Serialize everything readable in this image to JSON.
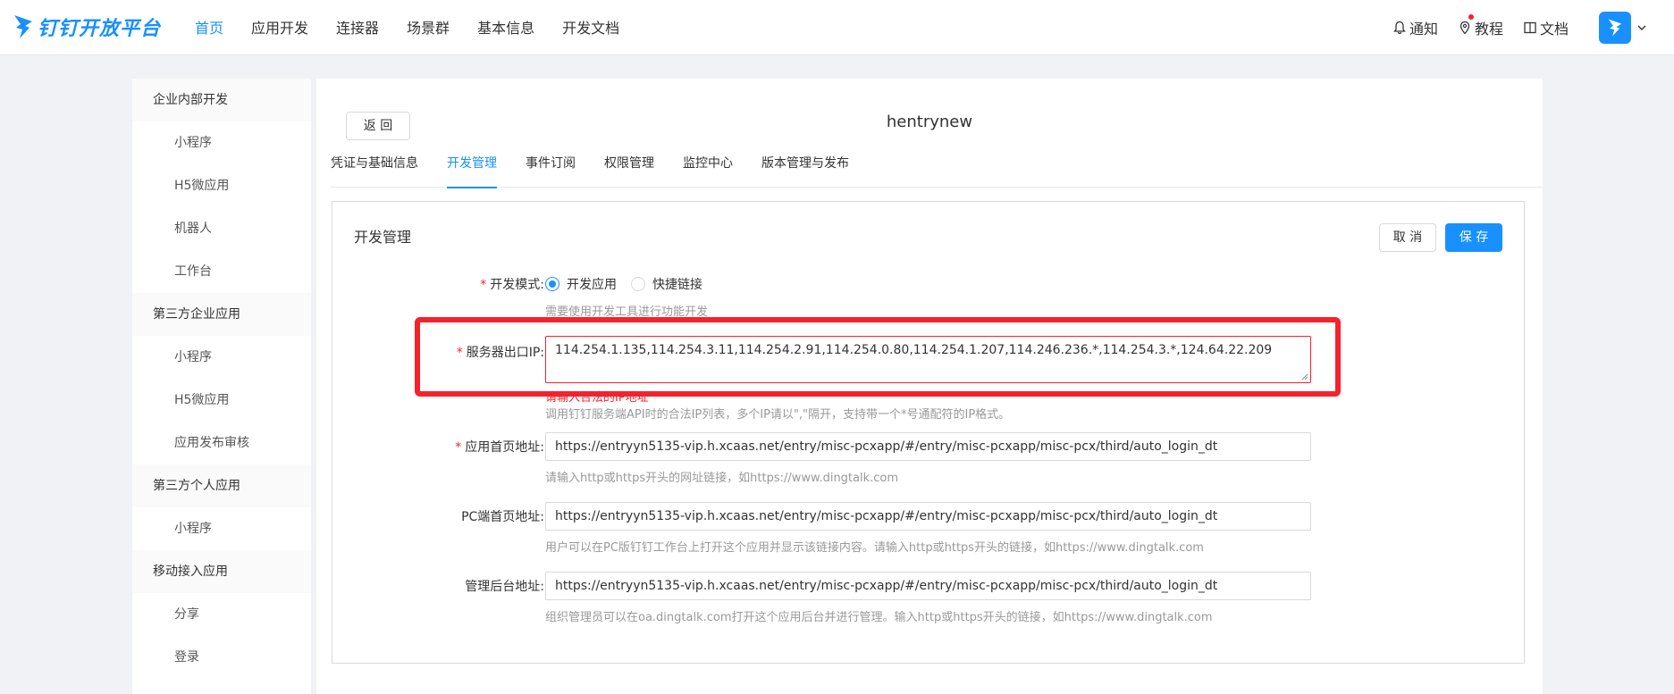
{
  "brand": {
    "name": "钉钉开放平台"
  },
  "nav": [
    "首页",
    "应用开发",
    "连接器",
    "场景群",
    "基本信息",
    "开发文档"
  ],
  "top_right": {
    "notify": "通知",
    "tutorial": "教程",
    "docs": "文档"
  },
  "sidebar": [
    {
      "type": "group",
      "label": "企业内部开发"
    },
    {
      "type": "item",
      "label": "小程序"
    },
    {
      "type": "item",
      "label": "H5微应用"
    },
    {
      "type": "item",
      "label": "机器人"
    },
    {
      "type": "item",
      "label": "工作台"
    },
    {
      "type": "group",
      "label": "第三方企业应用"
    },
    {
      "type": "item",
      "label": "小程序"
    },
    {
      "type": "item",
      "label": "H5微应用"
    },
    {
      "type": "item",
      "label": "应用发布审核"
    },
    {
      "type": "group",
      "label": "第三方个人应用"
    },
    {
      "type": "item",
      "label": "小程序"
    },
    {
      "type": "group",
      "label": "移动接入应用"
    },
    {
      "type": "item",
      "label": "分享"
    },
    {
      "type": "item",
      "label": "登录"
    }
  ],
  "main": {
    "back_label": "返 回",
    "app_name": "hentrynew",
    "tabs": [
      "凭证与基础信息",
      "开发管理",
      "事件订阅",
      "权限管理",
      "监控中心",
      "版本管理与发布"
    ],
    "active_tab": "开发管理"
  },
  "panel": {
    "title": "开发管理",
    "cancel_label": "取 消",
    "save_label": "保 存",
    "dev_mode": {
      "label": "开发模式:",
      "options": [
        "开发应用",
        "快捷链接"
      ],
      "selected": "开发应用",
      "help": "需要使用开发工具进行功能开发"
    },
    "server_ip": {
      "label": "服务器出口IP:",
      "value": "114.254.1.135,114.254.3.11,114.254.2.91,114.254.0.80,114.254.1.207,114.246.236.*,114.254.3.*,124.64.22.209",
      "error": "请输入合法的IP地址",
      "help": "调用钉钉服务端API时的合法IP列表，多个IP请以\",\"隔开，支持带一个*号通配符的IP格式。"
    },
    "home_url": {
      "label": "应用首页地址:",
      "value": "https://entryyn5135-vip.h.xcaas.net/entry/misc-pcxapp/#/entry/misc-pcxapp/misc-pcx/third/auto_login_dt",
      "help": "请输入http或https开头的网址链接，如https://www.dingtalk.com"
    },
    "pc_url": {
      "label": "PC端首页地址:",
      "value": "https://entryyn5135-vip.h.xcaas.net/entry/misc-pcxapp/#/entry/misc-pcxapp/misc-pcx/third/auto_login_dt",
      "help": "用户可以在PC版钉钉工作台上打开这个应用并显示该链接内容。请输入http或https开头的链接，如https://www.dingtalk.com"
    },
    "admin_url": {
      "label": "管理后台地址:",
      "value": "https://entryyn5135-vip.h.xcaas.net/entry/misc-pcxapp/#/entry/misc-pcxapp/misc-pcx/third/auto_login_dt",
      "help": "组织管理员可以在oa.dingtalk.com打开这个应用后台并进行管理。输入http或https开头的链接，如https://www.dingtalk.com"
    }
  },
  "colors": {
    "accent": "#1890ff",
    "error": "#f5222d",
    "annotation": "#f5222d"
  }
}
